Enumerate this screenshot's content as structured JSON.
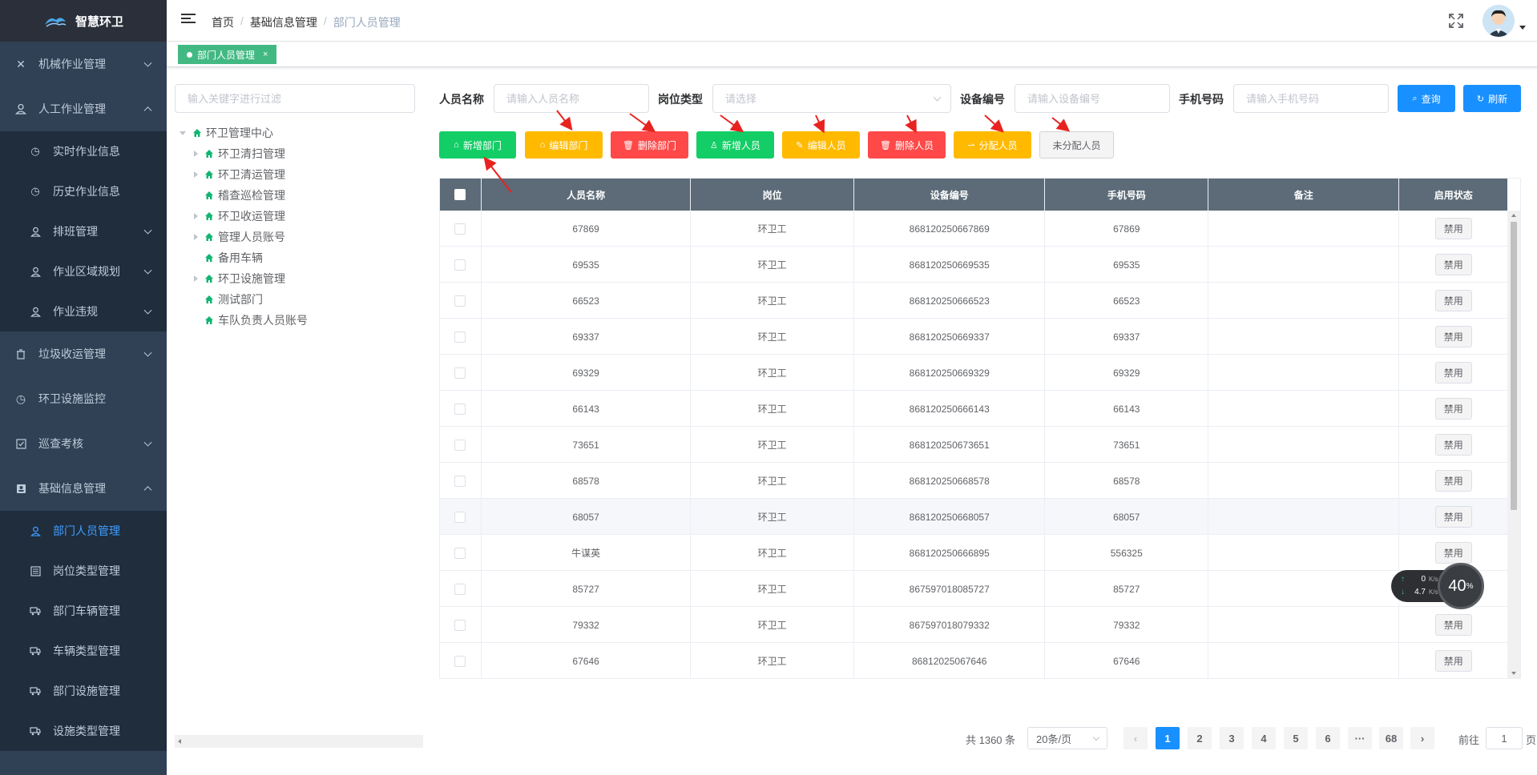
{
  "app": {
    "logo_text": "智慧环卫"
  },
  "sidebar": {
    "menus": [
      {
        "label": "机械作业管理",
        "icon": "tools-icon",
        "expanded": false
      },
      {
        "label": "人工作业管理",
        "icon": "user-icon",
        "expanded": true,
        "children": [
          {
            "label": "实时作业信息",
            "icon": "clock-icon"
          },
          {
            "label": "历史作业信息",
            "icon": "clock-icon"
          },
          {
            "label": "排班管理",
            "icon": "user-icon",
            "has_children": true
          },
          {
            "label": "作业区域规划",
            "icon": "user-icon",
            "has_children": true
          },
          {
            "label": "作业违规",
            "icon": "user-icon",
            "has_children": true
          }
        ]
      },
      {
        "label": "垃圾收运管理",
        "icon": "trash-icon",
        "expanded": false
      },
      {
        "label": "环卫设施监控",
        "icon": "clock-icon",
        "expanded": false
      },
      {
        "label": "巡查考核",
        "icon": "checkbox-icon",
        "expanded": false
      },
      {
        "label": "基础信息管理",
        "icon": "id-card-icon",
        "expanded": true,
        "children": [
          {
            "label": "部门人员管理",
            "icon": "user-icon",
            "active": true
          },
          {
            "label": "岗位类型管理",
            "icon": "list-icon"
          },
          {
            "label": "部门车辆管理",
            "icon": "truck-icon"
          },
          {
            "label": "车辆类型管理",
            "icon": "truck-icon"
          },
          {
            "label": "部门设施管理",
            "icon": "truck-icon"
          },
          {
            "label": "设施类型管理",
            "icon": "truck-icon"
          }
        ]
      }
    ]
  },
  "header": {
    "breadcrumb": [
      "首页",
      "基础信息管理",
      "部门人员管理"
    ]
  },
  "tags": [
    {
      "label": "部门人员管理",
      "active": true
    }
  ],
  "tree": {
    "search_placeholder": "输入关键字进行过滤",
    "root": "环卫管理中心",
    "nodes": [
      {
        "label": "环卫清扫管理",
        "has_children": true
      },
      {
        "label": "环卫清运管理",
        "has_children": true
      },
      {
        "label": "稽查巡检管理",
        "has_children": false
      },
      {
        "label": "环卫收运管理",
        "has_children": true
      },
      {
        "label": "管理人员账号",
        "has_children": true
      },
      {
        "label": "备用车辆",
        "has_children": false
      },
      {
        "label": "环卫设施管理",
        "has_children": true
      },
      {
        "label": "测试部门",
        "has_children": false
      },
      {
        "label": "车队负责人员账号",
        "has_children": false
      }
    ]
  },
  "search": {
    "name_label": "人员名称",
    "name_placeholder": "请输入人员名称",
    "post_label": "岗位类型",
    "post_placeholder": "请选择",
    "device_label": "设备编号",
    "device_placeholder": "请输入设备编号",
    "phone_label": "手机号码",
    "phone_placeholder": "请输入手机号码",
    "query_btn": "查询",
    "refresh_btn": "刷新"
  },
  "toolbar": {
    "add_dept": "新增部门",
    "edit_dept": "编辑部门",
    "del_dept": "删除部门",
    "add_person": "新增人员",
    "edit_person": "编辑人员",
    "del_person": "删除人员",
    "assign_person": "分配人员",
    "unassigned_person": "未分配人员"
  },
  "table": {
    "headers": [
      "人员名称",
      "岗位",
      "设备编号",
      "手机号码",
      "备注",
      "启用状态"
    ],
    "action_label": "禁用",
    "rows": [
      {
        "name": "67869",
        "post": "环卫工",
        "device": "868120250667869",
        "phone": "67869",
        "remark": ""
      },
      {
        "name": "69535",
        "post": "环卫工",
        "device": "868120250669535",
        "phone": "69535",
        "remark": ""
      },
      {
        "name": "66523",
        "post": "环卫工",
        "device": "868120250666523",
        "phone": "66523",
        "remark": ""
      },
      {
        "name": "69337",
        "post": "环卫工",
        "device": "868120250669337",
        "phone": "69337",
        "remark": ""
      },
      {
        "name": "69329",
        "post": "环卫工",
        "device": "868120250669329",
        "phone": "69329",
        "remark": ""
      },
      {
        "name": "66143",
        "post": "环卫工",
        "device": "868120250666143",
        "phone": "66143",
        "remark": ""
      },
      {
        "name": "73651",
        "post": "环卫工",
        "device": "868120250673651",
        "phone": "73651",
        "remark": ""
      },
      {
        "name": "68578",
        "post": "环卫工",
        "device": "868120250668578",
        "phone": "68578",
        "remark": ""
      },
      {
        "name": "68057",
        "post": "环卫工",
        "device": "868120250668057",
        "phone": "68057",
        "remark": ""
      },
      {
        "name": "牛谋英",
        "post": "环卫工",
        "device": "868120250666895",
        "phone": "556325",
        "remark": ""
      },
      {
        "name": "85727",
        "post": "环卫工",
        "device": "867597018085727",
        "phone": "85727",
        "remark": ""
      },
      {
        "name": "79332",
        "post": "环卫工",
        "device": "867597018079332",
        "phone": "79332",
        "remark": ""
      },
      {
        "name": "67646",
        "post": "环卫工",
        "device": "86812025067646",
        "phone": "67646",
        "remark": ""
      }
    ]
  },
  "pagination": {
    "total": "共 1360 条",
    "page_size": "20条/页",
    "pages": [
      "1",
      "2",
      "3",
      "4",
      "5",
      "6",
      "···",
      "68"
    ],
    "current": "1",
    "goto_label": "前往",
    "goto_value": "1",
    "page_suffix": "页"
  },
  "net_widget": {
    "up": "0",
    "up_unit": "K/s",
    "down": "4.7",
    "down_unit": "K/s",
    "percent": "40",
    "percent_unit": "%"
  },
  "colors": {
    "sidebar_bg": "#304156",
    "accent": "#1890ff",
    "green": "#13ce66",
    "yellow": "#ffba00",
    "red": "#ff4949",
    "table_header": "#5c6b77"
  }
}
